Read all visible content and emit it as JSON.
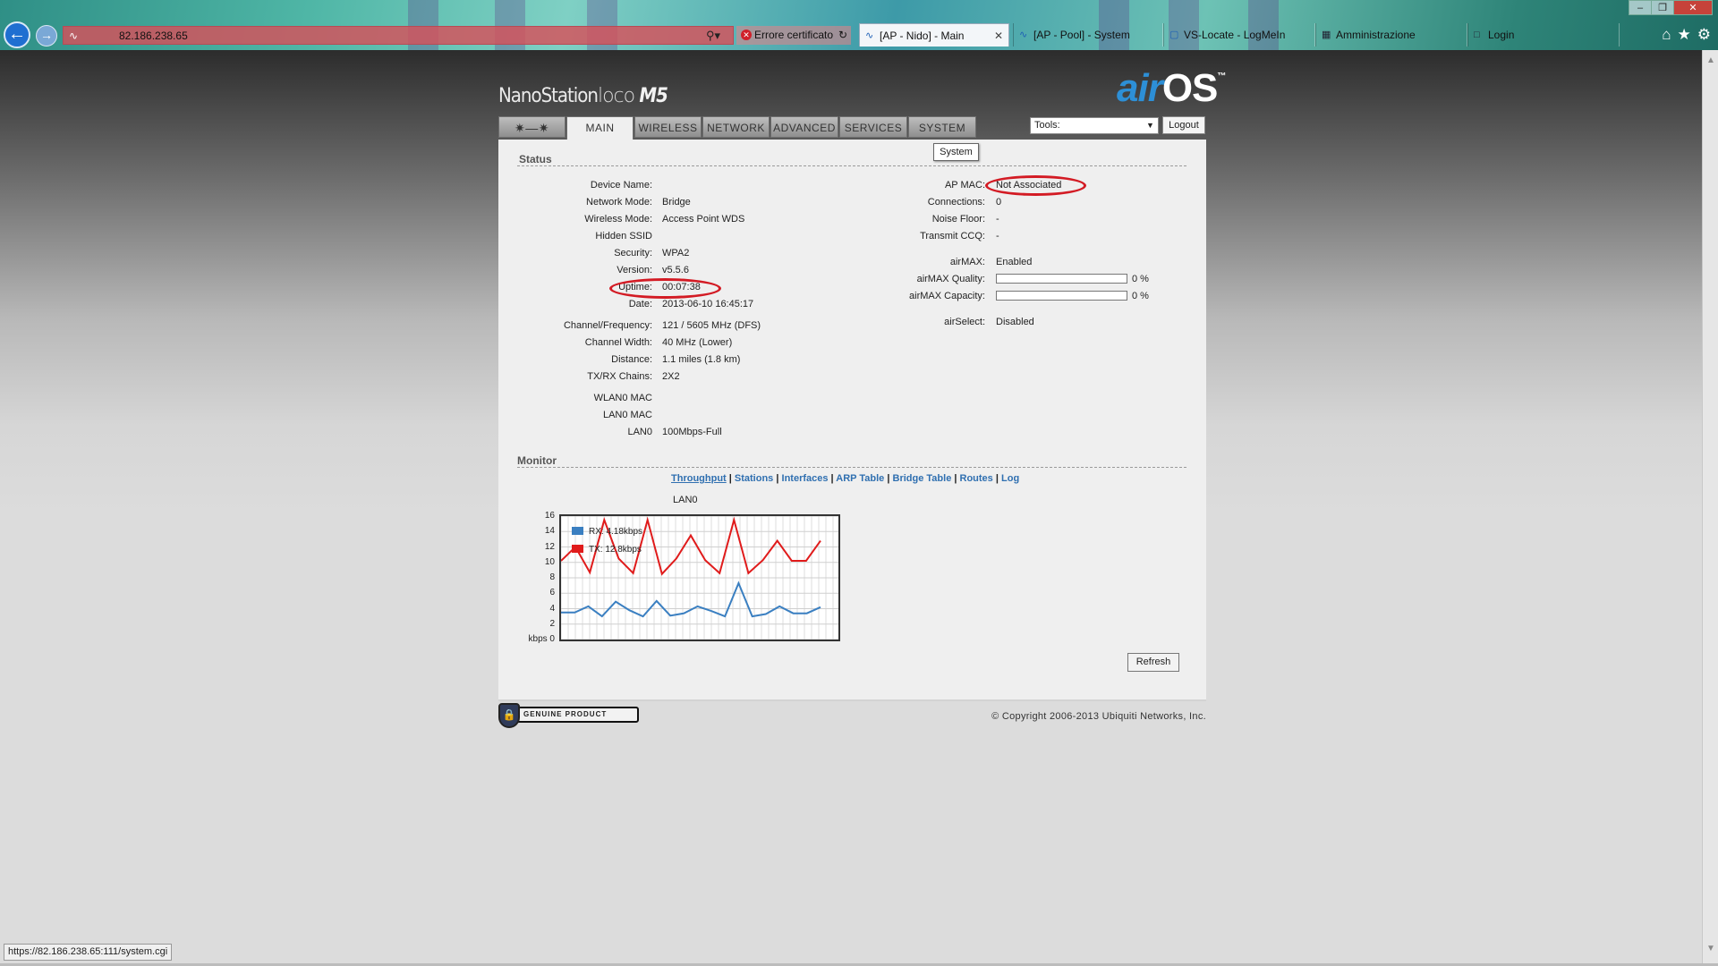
{
  "browser": {
    "address": "82.186.238.65",
    "cert_error": "Errore certificato",
    "tabs": [
      {
        "label": "[AP - Nido] - Main",
        "active": true
      },
      {
        "label": "[AP - Pool] - System",
        "active": false
      },
      {
        "label": "VS-Locate - LogMeIn",
        "active": false
      },
      {
        "label": "Amministrazione",
        "active": false
      },
      {
        "label": "Login",
        "active": false
      }
    ],
    "status_url": "https://82.186.238.65:111/system.cgi"
  },
  "header": {
    "brand_prefix": "NanoStation",
    "brand_model": "loco",
    "brand_suffix": "M5",
    "logo_air": "air",
    "logo_os": "OS",
    "logo_tm": "™"
  },
  "nav": {
    "tabs": [
      "MAIN",
      "WIRELESS",
      "NETWORK",
      "ADVANCED",
      "SERVICES",
      "SYSTEM"
    ],
    "active": "MAIN",
    "tools_label": "Tools:",
    "logout_label": "Logout",
    "tooltip": "System"
  },
  "status": {
    "title": "Status",
    "left": [
      {
        "label": "Device Name:",
        "value": ""
      },
      {
        "label": "Network Mode:",
        "value": "Bridge"
      },
      {
        "label": "Wireless Mode:",
        "value": "Access Point WDS"
      },
      {
        "label": "Hidden SSID",
        "value": ""
      },
      {
        "label": "Security:",
        "value": "WPA2"
      },
      {
        "label": "Version:",
        "value": "v5.5.6"
      },
      {
        "label": "Uptime:",
        "value": "00:07:38"
      },
      {
        "label": "Date:",
        "value": "2013-06-10 16:45:17"
      },
      {
        "label": "Channel/Frequency:",
        "value": "121 / 5605 MHz (DFS)"
      },
      {
        "label": "Channel Width:",
        "value": "40 MHz (Lower)"
      },
      {
        "label": "Distance:",
        "value": "1.1 miles (1.8 km)"
      },
      {
        "label": "TX/RX Chains:",
        "value": "2X2"
      },
      {
        "label": "WLAN0 MAC",
        "value": ""
      },
      {
        "label": "LAN0 MAC",
        "value": ""
      },
      {
        "label": "LAN0",
        "value": "100Mbps-Full"
      }
    ],
    "right": [
      {
        "label": "AP MAC:",
        "value": "Not Associated"
      },
      {
        "label": "Connections:",
        "value": "0"
      },
      {
        "label": "Noise Floor:",
        "value": "-"
      },
      {
        "label": "Transmit CCQ:",
        "value": "-"
      },
      {
        "label": "airMAX:",
        "value": "Enabled"
      },
      {
        "label": "airMAX Quality:",
        "value": "0 %",
        "bar": 0
      },
      {
        "label": "airMAX Capacity:",
        "value": "0 %",
        "bar": 0
      },
      {
        "label": "airSelect:",
        "value": "Disabled"
      }
    ]
  },
  "monitor": {
    "title": "Monitor",
    "links": [
      "Throughput",
      "Stations",
      "Interfaces",
      "ARP Table",
      "Bridge Table",
      "Routes",
      "Log"
    ],
    "selected": "Throughput",
    "refresh_label": "Refresh"
  },
  "chart_data": {
    "type": "line",
    "title": "LAN0",
    "ylabel": "kbps",
    "ylim": [
      0,
      16
    ],
    "yticks": [
      0,
      2,
      4,
      6,
      8,
      10,
      12,
      14,
      16
    ],
    "x": [
      0,
      1,
      2,
      3,
      4,
      5,
      6,
      7,
      8,
      9,
      10,
      11,
      12,
      13,
      14,
      15,
      16,
      17,
      18,
      19,
      20,
      21,
      22,
      23,
      24,
      25,
      26,
      27
    ],
    "series": [
      {
        "name": "RX: 4.18kbps",
        "color": "#3a7fc1",
        "values": [
          3.5,
          3.5,
          4.3,
          3.0,
          4.9,
          3.8,
          3.0,
          5.0,
          3.1,
          3.4,
          4.3,
          3.7,
          3.0,
          7.3,
          3.0,
          3.3,
          4.3,
          3.4,
          3.4,
          4.2
        ]
      },
      {
        "name": "TX: 12.8kbps",
        "color": "#e01b1b",
        "values": [
          10.2,
          12.0,
          8.7,
          15.5,
          10.5,
          8.6,
          15.5,
          8.5,
          10.5,
          13.5,
          10.3,
          8.6,
          15.5,
          8.6,
          10.3,
          12.8,
          10.2,
          10.2,
          12.8
        ]
      }
    ]
  },
  "footer": {
    "badge_text": "GENUINE    PRODUCT",
    "copyright": "© Copyright 2006-2013 Ubiquiti Networks, Inc."
  }
}
